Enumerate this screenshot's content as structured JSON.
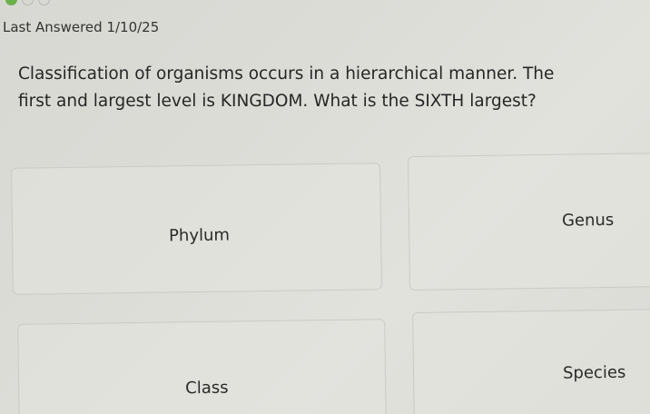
{
  "header": {
    "last_answered": "Last Answered 1/10/25"
  },
  "question": {
    "text": "Classification of organisms occurs in a hierarchical manner. The first and largest level is KINGDOM. What is the SIXTH largest?"
  },
  "options": [
    {
      "label": "Phylum"
    },
    {
      "label": "Genus"
    },
    {
      "label": "Class"
    },
    {
      "label": "Species"
    }
  ],
  "colors": {
    "progress_dot_filled": "#6cb04a"
  }
}
